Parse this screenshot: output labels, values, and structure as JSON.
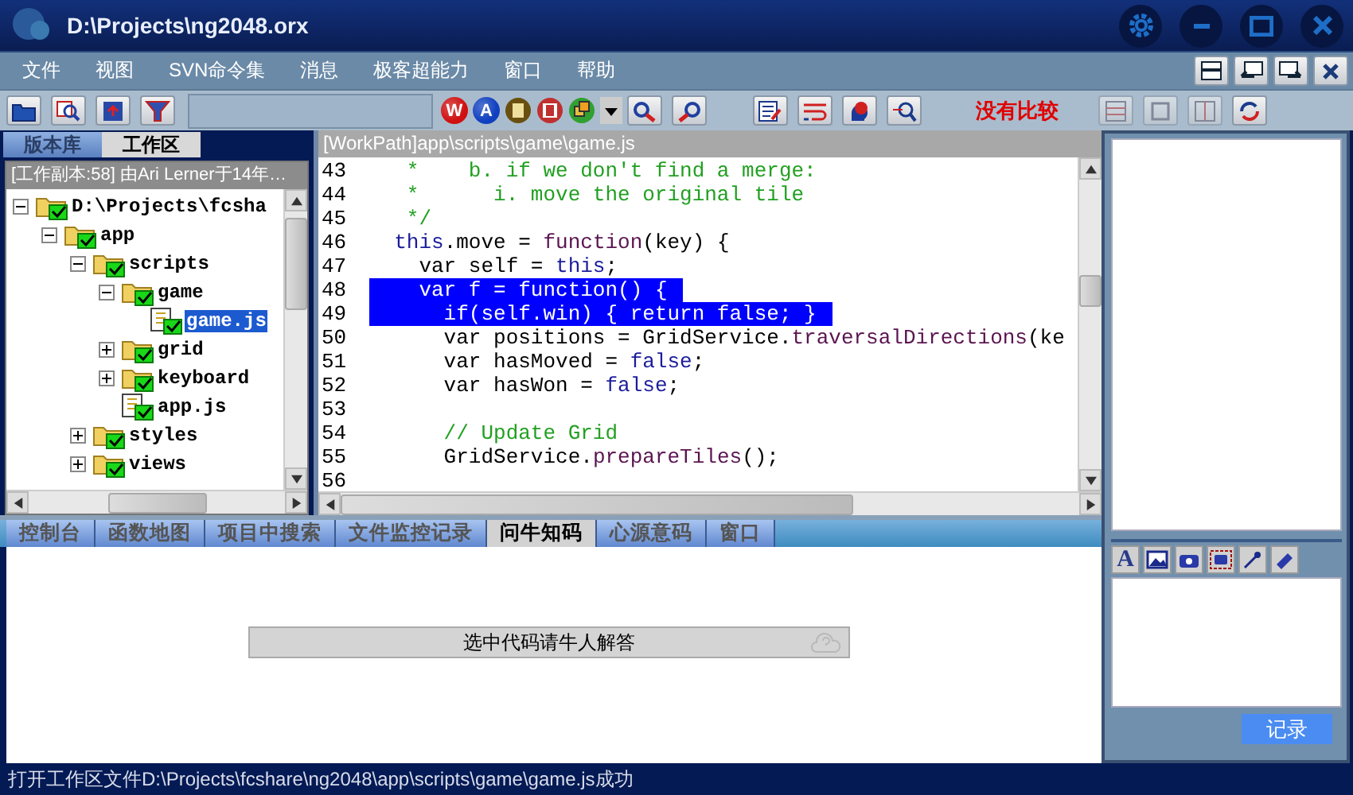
{
  "window": {
    "title": "D:\\Projects\\ng2048.orx"
  },
  "menu": [
    "文件",
    "视图",
    "SVN命令集",
    "消息",
    "极客超能力",
    "窗口",
    "帮助"
  ],
  "toolbar": {
    "letter_buttons": [
      "W",
      "A"
    ],
    "compare_status": "没有比较"
  },
  "left_panel": {
    "tabs": [
      {
        "label": "版本库",
        "selected": false
      },
      {
        "label": "工作区",
        "selected": true
      }
    ],
    "header": "[工作副本:58] 由Ari Lerner于14年…",
    "tree": [
      {
        "label": "D:\\Projects\\fcsha",
        "kind": "folder",
        "expanded": true,
        "selected": false,
        "children": [
          {
            "label": "app",
            "kind": "folder",
            "expanded": true,
            "selected": false,
            "children": [
              {
                "label": "scripts",
                "kind": "folder",
                "expanded": true,
                "selected": false,
                "children": [
                  {
                    "label": "game",
                    "kind": "folder",
                    "expanded": true,
                    "selected": false,
                    "children": [
                      {
                        "label": "game.js",
                        "kind": "file",
                        "selected": true
                      }
                    ]
                  },
                  {
                    "label": "grid",
                    "kind": "folder",
                    "expanded": false,
                    "selected": false
                  },
                  {
                    "label": "keyboard",
                    "kind": "folder",
                    "expanded": false,
                    "selected": false
                  },
                  {
                    "label": "app.js",
                    "kind": "file",
                    "selected": false
                  }
                ]
              },
              {
                "label": "styles",
                "kind": "folder",
                "expanded": false,
                "selected": false
              },
              {
                "label": "views",
                "kind": "folder",
                "expanded": false,
                "selected": false
              }
            ]
          }
        ]
      }
    ]
  },
  "editor": {
    "path": "[WorkPath]app\\scripts\\game\\game.js",
    "lines": [
      {
        "number": "43",
        "selected": false,
        "tokens": [
          {
            "kind": "comment",
            "text": "   *    b. if we don't find a merge:"
          }
        ]
      },
      {
        "number": "44",
        "selected": false,
        "tokens": [
          {
            "kind": "comment",
            "text": "   *      i. move the original tile"
          }
        ]
      },
      {
        "number": "45",
        "selected": false,
        "tokens": [
          {
            "kind": "comment",
            "text": "   */"
          }
        ]
      },
      {
        "number": "46",
        "selected": false,
        "tokens": [
          {
            "kind": "keyword",
            "text": "  this"
          },
          {
            "kind": "plain",
            "text": ".move = "
          },
          {
            "kind": "function",
            "text": "function"
          },
          {
            "kind": "plain",
            "text": "(key) {"
          }
        ]
      },
      {
        "number": "47",
        "selected": false,
        "tokens": [
          {
            "kind": "plain",
            "text": "    var self = "
          },
          {
            "kind": "keyword",
            "text": "this"
          },
          {
            "kind": "plain",
            "text": ";"
          }
        ]
      },
      {
        "number": "48",
        "selected": true,
        "tokens": [
          {
            "kind": "plain",
            "text": "    var f = "
          },
          {
            "kind": "function",
            "text": "function"
          },
          {
            "kind": "plain",
            "text": "() {"
          }
        ]
      },
      {
        "number": "49",
        "selected": true,
        "tokens": [
          {
            "kind": "plain",
            "text": "      if(self.win) { return false; }"
          }
        ]
      },
      {
        "number": "50",
        "selected": false,
        "tokens": [
          {
            "kind": "plain",
            "text": "      var positions = GridService."
          },
          {
            "kind": "function",
            "text": "traversalDirections"
          },
          {
            "kind": "plain",
            "text": "(ke"
          }
        ]
      },
      {
        "number": "51",
        "selected": false,
        "tokens": [
          {
            "kind": "plain",
            "text": "      var hasMoved = "
          },
          {
            "kind": "keyword",
            "text": "false"
          },
          {
            "kind": "plain",
            "text": ";"
          }
        ]
      },
      {
        "number": "52",
        "selected": false,
        "tokens": [
          {
            "kind": "plain",
            "text": "      var hasWon = "
          },
          {
            "kind": "keyword",
            "text": "false"
          },
          {
            "kind": "plain",
            "text": ";"
          }
        ]
      },
      {
        "number": "53",
        "selected": false
      },
      {
        "number": "54",
        "selected": false,
        "tokens": [
          {
            "kind": "comment",
            "text": "      // Update Grid"
          }
        ]
      },
      {
        "number": "55",
        "selected": false,
        "tokens": [
          {
            "kind": "plain",
            "text": "      GridService."
          },
          {
            "kind": "function",
            "text": "prepareTiles"
          },
          {
            "kind": "plain",
            "text": "();"
          }
        ]
      },
      {
        "number": "56",
        "selected": false
      }
    ]
  },
  "bottom_panel": {
    "tabs": [
      {
        "label": "控制台",
        "selected": false
      },
      {
        "label": "函数地图",
        "selected": false
      },
      {
        "label": "项目中搜索",
        "selected": false
      },
      {
        "label": "文件监控记录",
        "selected": false
      },
      {
        "label": "问牛知码",
        "selected": true
      },
      {
        "label": "心源意码",
        "selected": false
      },
      {
        "label": "窗口",
        "selected": false
      }
    ],
    "ask_bar": "选中代码请牛人解答"
  },
  "right_panel": {
    "text_tool": "A",
    "record_button": "记录"
  },
  "status_bar": "打开工作区文件D:\\Projects\\fcshare\\ng2048\\app\\scripts\\game\\game.js成功"
}
